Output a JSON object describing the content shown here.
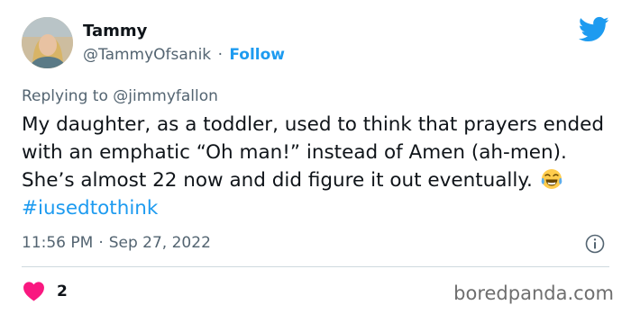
{
  "author": {
    "name": "Tammy",
    "handle": "@TammyOfsanik",
    "separator": "·",
    "follow_label": "Follow"
  },
  "reply": {
    "prefix": "Replying to",
    "mention": "@jimmyfallon"
  },
  "tweet": {
    "text_before_emoji": "My daughter, as a toddler, used to think that prayers ended with an emphatic “Oh man!” instead of Amen (ah-men). She’s almost 22 now and did figure it out eventually.",
    "emoji_icon": "face-with-tears-of-joy-icon",
    "hashtag": "#iusedtothink"
  },
  "meta": {
    "time": "11:56 PM",
    "separator": "·",
    "date": "Sep 27, 2022"
  },
  "engagement": {
    "like_icon": "heart-icon",
    "like_count": "2"
  },
  "icons": {
    "platform": "twitter-bird-icon",
    "info": "info-icon"
  },
  "watermark": "boredpanda.com",
  "colors": {
    "accent": "#1d9bf0",
    "muted_text": "#536471",
    "heart": "#f91880",
    "divider": "#cfd9de",
    "watermark": "#6e6e6e"
  }
}
